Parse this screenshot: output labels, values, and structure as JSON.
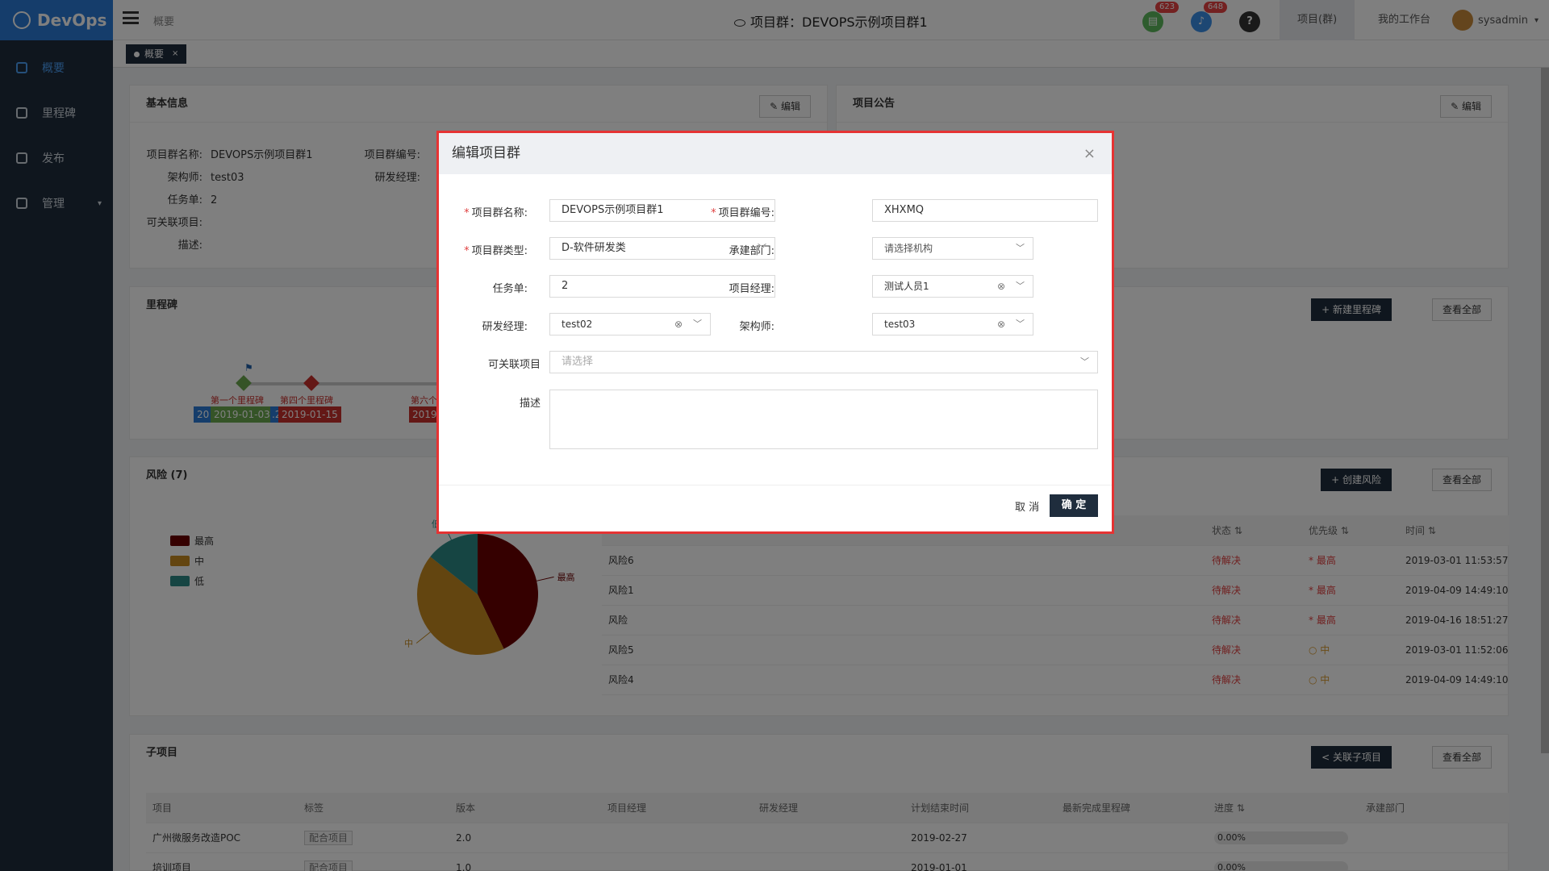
{
  "app": {
    "name": "DevOps"
  },
  "sidebar": {
    "items": [
      {
        "label": "概要"
      },
      {
        "label": "里程碑"
      },
      {
        "label": "发布"
      },
      {
        "label": "管理"
      }
    ]
  },
  "header": {
    "breadcrumb": "概要",
    "title": "项目群：DEVOPS示例项目群1",
    "badge1": "623",
    "badge2": "648",
    "help": "?",
    "menu1": "项目(群)",
    "menu2": "我的工作台",
    "user": "sysadmin"
  },
  "tab": {
    "label": "概要",
    "close": "×"
  },
  "basic": {
    "title": "基本信息",
    "edit": "编辑",
    "fields": [
      {
        "k": "项目群名称:",
        "v": "DEVOPS示例项目群1"
      },
      {
        "k": "架构师:",
        "v": "test03"
      },
      {
        "k": "任务单:",
        "v": "2"
      },
      {
        "k": "可关联项目:",
        "v": ""
      },
      {
        "k": "描述:",
        "v": ""
      },
      {
        "k": "项目群编号:",
        "v": ""
      },
      {
        "k": "研发经理:",
        "v": ""
      }
    ]
  },
  "notice": {
    "title": "项目公告",
    "edit": "编辑"
  },
  "milestone": {
    "title": "里程碑",
    "new": "新建里程碑",
    "all": "查看全部",
    "labels": [
      "第一个里程碑",
      "第四个里程碑",
      "第六个"
    ],
    "dates": [
      "2019-01-03",
      "2019-01-15",
      "2019"
    ],
    "prefix1": "20",
    "prefix2": ".2"
  },
  "risk": {
    "title": "风险 (7)",
    "create": "创建风险",
    "all": "查看全部",
    "legend": [
      "最高",
      "中",
      "低"
    ],
    "cols": [
      "",
      "状态",
      "优先级",
      "时间"
    ],
    "rows": [
      {
        "name": "风险6",
        "status": "待解决",
        "prio": "最高",
        "time": "2019-03-01 11:53:57"
      },
      {
        "name": "风险1",
        "status": "待解决",
        "prio": "最高",
        "time": "2019-04-09 14:49:10"
      },
      {
        "name": "风险",
        "status": "待解决",
        "prio": "最高",
        "time": "2019-04-16 18:51:27"
      },
      {
        "name": "风险5",
        "status": "待解决",
        "prio": "中",
        "time": "2019-03-01 11:52:06"
      },
      {
        "name": "风险4",
        "status": "待解决",
        "prio": "中",
        "time": "2019-04-09 14:49:10"
      }
    ]
  },
  "sub": {
    "title": "子项目",
    "link": "关联子项目",
    "all": "查看全部",
    "cols": [
      "项目",
      "标签",
      "版本",
      "项目经理",
      "研发经理",
      "计划结束时间",
      "最新完成里程碑",
      "进度",
      "承建部门"
    ],
    "rows": [
      {
        "name": "广州微服务改造POC",
        "tag": "配合项目",
        "ver": "2.0",
        "end": "2019-02-27",
        "prog": "0.00%"
      },
      {
        "name": "培训项目",
        "tag": "配合项目",
        "ver": "1.0",
        "end": "2019-01-01",
        "prog": "0.00%"
      }
    ]
  },
  "modal": {
    "title": "编辑项目群",
    "close": "×",
    "name_label": "项目群名称:",
    "name_value": "DEVOPS示例项目群1",
    "code_label": "项目群编号:",
    "code_value": "XHXMQ",
    "type_label": "项目群类型:",
    "type_value": "D-软件研发类",
    "dept_label": "承建部门:",
    "dept_placeholder": "请选择机构",
    "task_label": "任务单:",
    "task_value": "2",
    "pm_label": "项目经理:",
    "pm_value": "测试人员1",
    "rd_label": "研发经理:",
    "rd_value": "test02",
    "arch_label": "架构师:",
    "arch_value": "test03",
    "link_label": "可关联项目",
    "link_placeholder": "请选择",
    "desc_label": "描述",
    "cancel": "取 消",
    "ok": "确 定"
  },
  "chart_data": {
    "type": "pie",
    "slices": [
      {
        "label": "最高",
        "value": 3,
        "color": "#6b0000"
      },
      {
        "label": "中",
        "value": 3,
        "color": "#c78a20"
      },
      {
        "label": "低",
        "value": 1,
        "color": "#2c8a87"
      }
    ]
  },
  "colors": {
    "sidebar": "#1f2d3d",
    "accent": "#2a7bd6",
    "danger": "#e04040"
  }
}
